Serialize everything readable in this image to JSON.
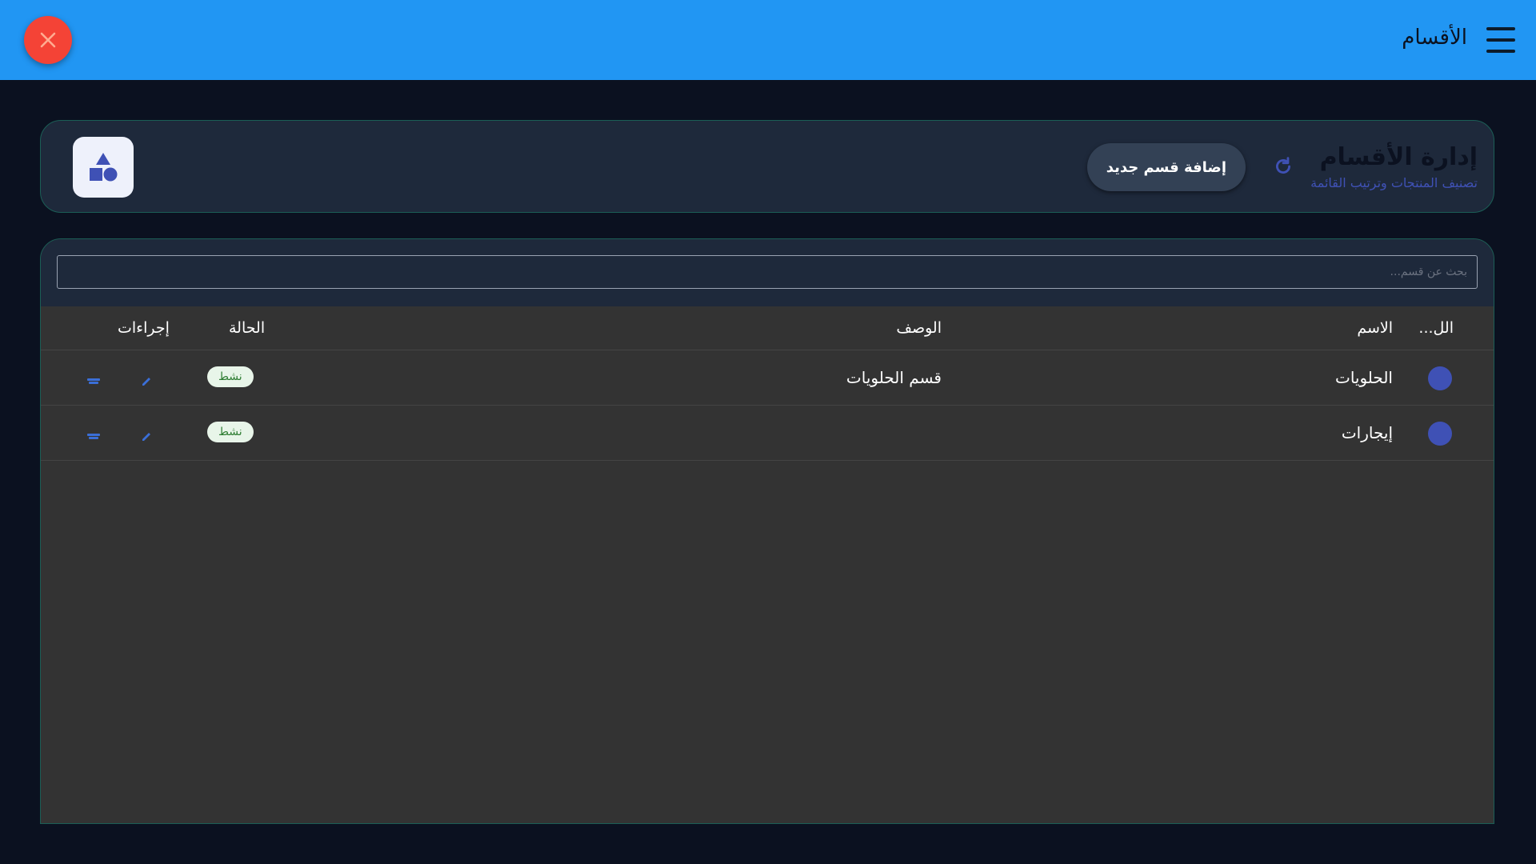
{
  "appbar": {
    "title": "الأقسام",
    "menu_icon": "menu-icon",
    "close_icon": "close-icon",
    "close_color": "#f44336",
    "background": "#2196f3"
  },
  "header": {
    "title": "إدارة الأقسام",
    "subtitle": "تصنيف المنتجات وترتيب القائمة",
    "add_button_label": "إضافة قسم جديد",
    "refresh_icon": "refresh-icon",
    "logo_icon": "shapes-icon"
  },
  "search": {
    "placeholder": "بحث عن قسم..."
  },
  "table": {
    "columns": {
      "color": "الل...",
      "name": "الاسم",
      "description": "الوصف",
      "status": "الحالة",
      "actions": "إجراءات"
    },
    "rows": [
      {
        "color": "#3f51b5",
        "name": "الحلويات",
        "description": "قسم الحلويات",
        "status": "نشط"
      },
      {
        "color": "#3f51b5",
        "name": "إيجارات",
        "description": "",
        "status": "نشط"
      }
    ]
  },
  "colors": {
    "accent": "#3f51b5",
    "status_active_bg": "#e8f5e9",
    "status_active_text": "#2e7d32",
    "card_border": "#1b5e56"
  }
}
